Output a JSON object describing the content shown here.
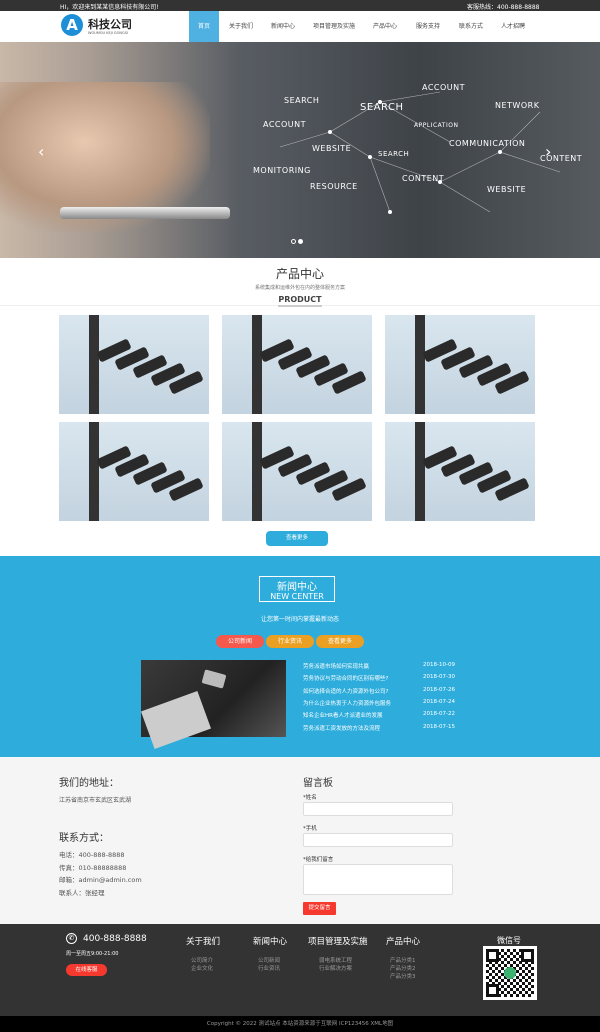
{
  "topbar": {
    "welcome": "HI，欢迎来到某某信息科技有限公司!",
    "hotline": "客服热线：400-888-8888"
  },
  "logo": {
    "name": "科技公司",
    "sub": "WOUMOU KEJI GONGSI",
    "letter": "A"
  },
  "nav": [
    "首页",
    "关于我们",
    "新闻中心",
    "项目管理及实施",
    "产品中心",
    "服务支持",
    "联系方式",
    "人才招聘"
  ],
  "hero": {
    "labels": [
      "SEARCH",
      "ACCOUNT",
      "SEARCH",
      "ACCOUNT",
      "NETWORK",
      "APPLICATION",
      "WEBSITE",
      "COMMUNICATION",
      "SEARCH",
      "CONTENT",
      "MONITORING",
      "CONTENT",
      "RESOURCE",
      "WEBSITE"
    ],
    "prev": "‹",
    "next": "›"
  },
  "products": {
    "title": "产品中心",
    "subtitle": "系统集成和运维外包在内的整体服务方案",
    "en": "PRODUCT",
    "more": "查看更多"
  },
  "news": {
    "title": "新闻中心",
    "en": "NEW CENTER",
    "subtitle": "让您第一时间内掌握最新动态",
    "tabs": [
      "公司新闻",
      "行业资讯",
      "查看更多"
    ],
    "items": [
      {
        "t": "劳务派遣市场如何实现共赢",
        "d": "2018-10-09"
      },
      {
        "t": "劳务协议与劳动合同的区别有哪些?",
        "d": "2018-07-30"
      },
      {
        "t": "如何选择合适的人力资源外包公司?",
        "d": "2018-07-26"
      },
      {
        "t": "为什么企业热衷于人力资源外包服务",
        "d": "2018-07-24"
      },
      {
        "t": "知名企业HR看人才派遣业的发展",
        "d": "2018-07-22"
      },
      {
        "t": "劳务派遣工资发放的方法及流程",
        "d": "2018-07-15"
      }
    ]
  },
  "contact": {
    "addr_title": "我们的地址：",
    "addr": "江苏省南京市玄武区玄武湖",
    "way_title": "联系方式：",
    "lines": [
      "电话：400-888-8888",
      "传真：010-88888888",
      "邮箱：admin@admin.com",
      "联系人：张经理"
    ]
  },
  "form": {
    "title": "留言板",
    "name": "*姓名",
    "phone": "*手机",
    "msg": "*给我们留言",
    "submit": "提交留言"
  },
  "footer": {
    "phone": "400-888-8888",
    "hours": "周一至周五9:00-21:00",
    "online": "在线客服",
    "cols": [
      {
        "h": "关于我们",
        "links": [
          "公司简介",
          "企业文化"
        ]
      },
      {
        "h": "新闻中心",
        "links": [
          "公司新闻",
          "行业资讯"
        ]
      },
      {
        "h": "项目管理及实施",
        "links": [
          "弱电系统工程",
          "行业解决方案"
        ]
      },
      {
        "h": "产品中心",
        "links": [
          "产品分类1",
          "产品分类2",
          "产品分类3"
        ]
      }
    ],
    "wechat": "微信号",
    "copyright": "Copyright © 2022 测试站点 本站资源来源于互联网  ICP123456  XML地图"
  },
  "colors": {
    "accent": "#2eaddc",
    "red": "#f5493c",
    "orange": "#eca023"
  }
}
